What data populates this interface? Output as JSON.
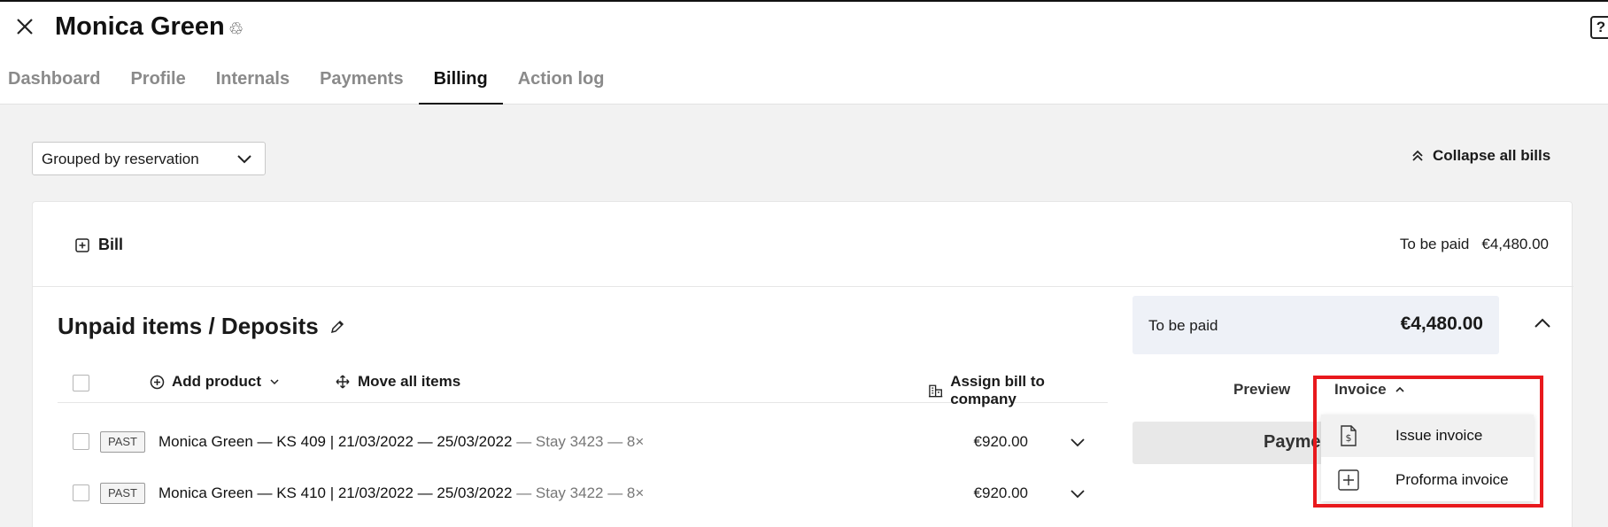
{
  "header": {
    "title": "Monica Green",
    "help_label": "?",
    "tabs": [
      {
        "label": "Dashboard",
        "active": false
      },
      {
        "label": "Profile",
        "active": false
      },
      {
        "label": "Internals",
        "active": false
      },
      {
        "label": "Payments",
        "active": false
      },
      {
        "label": "Billing",
        "active": true
      },
      {
        "label": "Action log",
        "active": false
      }
    ]
  },
  "controls": {
    "group_by_value": "Grouped by reservation",
    "collapse_all_label": "Collapse all bills"
  },
  "bill": {
    "label": "Bill",
    "to_be_paid_label": "To be paid",
    "to_be_paid_amount": "€4,480.00"
  },
  "section": {
    "title": "Unpaid items / Deposits",
    "add_product_label": "Add product",
    "move_all_label": "Move all items",
    "assign_company_label": "Assign bill to company"
  },
  "items": [
    {
      "badge": "PAST",
      "text": "Monica Green — KS 409 | 21/03/2022 — 25/03/2022",
      "muted": " — Stay 3423 — 8×",
      "price": "€920.00"
    },
    {
      "badge": "PAST",
      "text": "Monica Green — KS 410 | 21/03/2022 — 25/03/2022",
      "muted": " — Stay 3422 — 8×",
      "price": "€920.00"
    }
  ],
  "payment_panel": {
    "to_be_paid_label": "To be paid",
    "to_be_paid_amount": "€4,480.00",
    "preview_label": "Preview",
    "invoice_label": "Invoice",
    "payment_button_label": "Payment"
  },
  "invoice_menu": {
    "issue_label": "Issue invoice",
    "proforma_label": "Proforma invoice"
  },
  "colors": {
    "highlight": "#e8191d",
    "pay_box_bg": "#eef1f7"
  }
}
